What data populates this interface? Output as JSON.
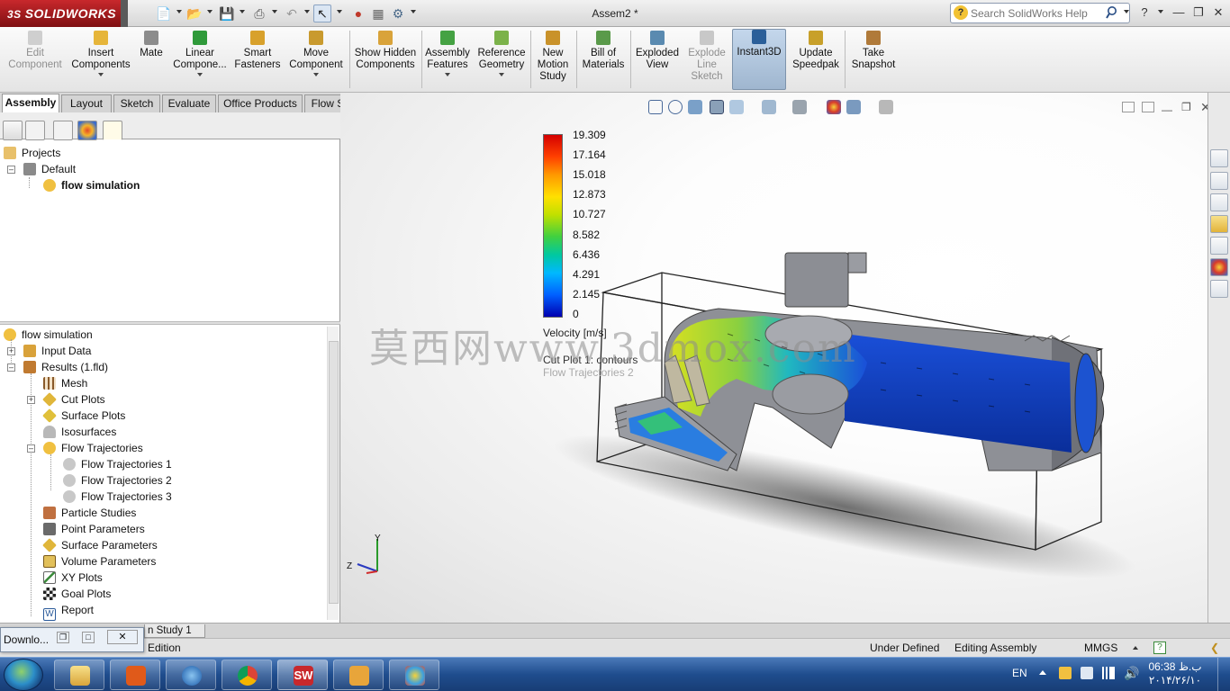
{
  "app": {
    "brand": "SOLIDWORKS",
    "brand_prefix": "3S",
    "document_title": "Assem2 *",
    "search_placeholder": "Search SolidWorks Help"
  },
  "commands": [
    {
      "label": "Edit Component",
      "enabled": false
    },
    {
      "label": "Insert Components",
      "has_dropdown": true
    },
    {
      "label": "Mate"
    },
    {
      "label": "Linear Compone...",
      "has_dropdown": true
    },
    {
      "label": "Smart Fasteners"
    },
    {
      "label": "Move Component",
      "has_dropdown": true
    },
    {
      "label": "Show Hidden Components"
    },
    {
      "label": "Assembly Features",
      "has_dropdown": true
    },
    {
      "label": "Reference Geometry",
      "has_dropdown": true
    },
    {
      "label": "New Motion Study"
    },
    {
      "label": "Bill of Materials"
    },
    {
      "label": "Exploded View"
    },
    {
      "label": "Explode Line Sketch",
      "enabled": false
    },
    {
      "label": "Instant3D",
      "active": true
    },
    {
      "label": "Update Speedpak"
    },
    {
      "label": "Take Snapshot"
    }
  ],
  "tabs": [
    "Assembly",
    "Layout",
    "Sketch",
    "Evaluate",
    "Office Products",
    "Flow Simulation"
  ],
  "active_tab": "Assembly",
  "project_tree": {
    "root": "Projects",
    "config": "Default",
    "project": "flow simulation"
  },
  "analysis_tree": {
    "root": "flow simulation",
    "input_data": "Input Data",
    "results": "Results (1.fld)",
    "items": [
      "Mesh",
      "Cut Plots",
      "Surface Plots",
      "Isosurfaces",
      "Flow Trajectories"
    ],
    "trajectories": [
      "Flow Trajectories 1",
      "Flow Trajectories 2",
      "Flow Trajectories 3"
    ],
    "more": [
      "Particle Studies",
      "Point Parameters",
      "Surface Parameters",
      "Volume Parameters",
      "XY Plots",
      "Goal Plots",
      "Report"
    ]
  },
  "legend": {
    "values": [
      "19.309",
      "17.164",
      "15.018",
      "12.873",
      "10.727",
      "8.582",
      "6.436",
      "4.291",
      "2.145",
      "0"
    ],
    "title": "Velocity [m/s]",
    "plot1": "Cut Plot 1: contours",
    "plot2": "Flow Trajectories 2"
  },
  "watermark": "莫西网www.3dmox.com",
  "axes": {
    "y": "Y",
    "z": "Z"
  },
  "bottom": {
    "download": "Downlo...",
    "study_tab": "n Study 1",
    "edition": "Edition"
  },
  "status": {
    "state": "Under Defined",
    "mode": "Editing Assembly",
    "units": "MMGS"
  },
  "taskbar": {
    "lang": "EN",
    "time": "06:38 ب.ظ",
    "date": "۲۰۱۴/۲۶/۱۰"
  },
  "colors": {
    "brand_red": "#c8282c",
    "active_cmd": "#a9bed6",
    "taskbar": "#1f4d8e"
  }
}
